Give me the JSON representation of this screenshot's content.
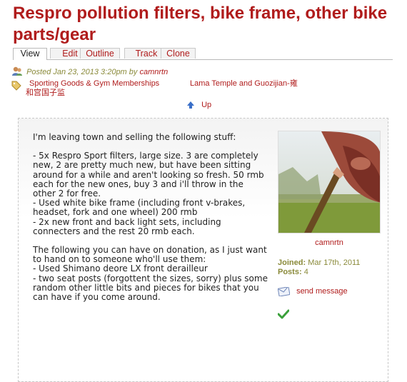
{
  "page": {
    "title": "Respro pollution filters, bike frame, other bike parts/gear"
  },
  "tabs": [
    {
      "label": "View",
      "active": true
    },
    {
      "label": "Edit"
    },
    {
      "label": "Outline"
    },
    {
      "label": "Track"
    },
    {
      "label": "Clone"
    }
  ],
  "meta": {
    "posted_text": "Posted Jan 23, 2013 3:20pm by",
    "author": "camnrtn"
  },
  "tags": [
    "Sporting Goods & Gym Memberships",
    "Lama Temple and Guozijian-雍",
    "和宫国子监"
  ],
  "nav": {
    "up_label": "Up"
  },
  "post": {
    "paragraphs": [
      "I'm leaving town and selling the following stuff:",
      "- 5x Respro Sport filters, large size. 3 are completely new, 2 are pretty much new, but have been sitting around for a while and aren't looking so fresh. 50 rmb each for the new ones, buy 3 and i'll throw in the other 2 for free.\n- Used white bike frame (including front v-brakes, headset, fork and one wheel) 200 rmb\n- 2x new front and back light sets, including connecters and the rest 20 rmb each.",
      "The following you can have on donation, as I just want to hand on to someone who'll use them:\n- Used Shimano deore LX front derailleur\n- two seat posts (forgottent the sizes, sorry) plus some random other little bits and pieces for bikes that you can have if you come around."
    ]
  },
  "user": {
    "name": "camnrtn",
    "joined_label": "Joined:",
    "joined_value": "Mar 17th, 2011",
    "posts_label": "Posts:",
    "posts_value": "4",
    "send_message_label": "send message"
  },
  "icons": {
    "user": "user-icon",
    "tag": "tag-icon",
    "up": "up-arrow-icon",
    "message": "envelope-icon",
    "check": "check-icon"
  },
  "colors": {
    "accent": "#b01c1c",
    "meta": "#8a8a3a"
  }
}
